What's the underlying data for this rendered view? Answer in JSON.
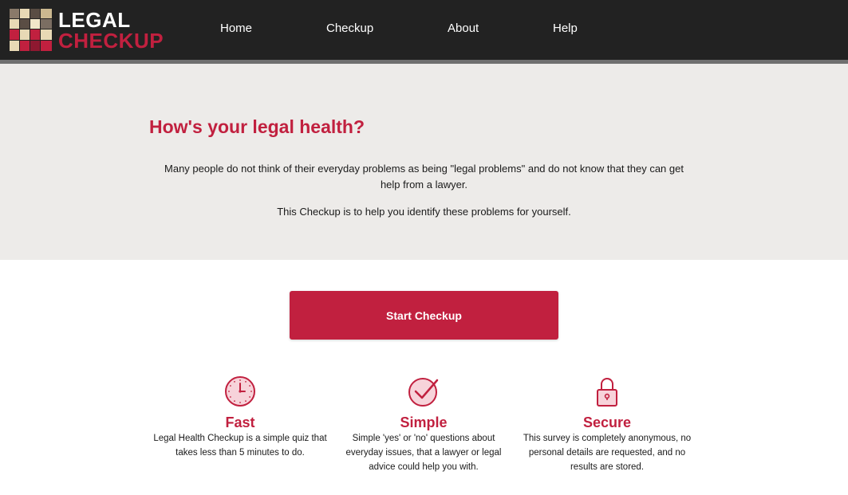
{
  "header": {
    "logo": {
      "line1": "LEGAL",
      "line2": "CHECKUP"
    },
    "nav": [
      {
        "label": "Home"
      },
      {
        "label": "Checkup"
      },
      {
        "label": "About"
      },
      {
        "label": "Help"
      }
    ]
  },
  "hero": {
    "title": "How's your legal health?",
    "paragraph1": "Many people do not think of their everyday problems as being \"legal problems\" and do not know that they can get help from a lawyer.",
    "paragraph2": "This Checkup is to help you identify these problems for yourself."
  },
  "cta": {
    "label": "Start Checkup"
  },
  "features": [
    {
      "icon": "clock-icon",
      "title": "Fast",
      "description": "Legal Health Checkup is a simple quiz that takes less than 5 minutes to do."
    },
    {
      "icon": "checkmark-circle-icon",
      "title": "Simple",
      "description": "Simple 'yes' or 'no' questions about everyday issues, that a lawyer or legal advice could help you with."
    },
    {
      "icon": "padlock-icon",
      "title": "Secure",
      "description": "This survey is completely anonymous, no personal details are requested, and no results are stored."
    }
  ],
  "colors": {
    "brand_red": "#c1203f",
    "header_bg": "#222222",
    "hero_bg": "#edebe9"
  }
}
